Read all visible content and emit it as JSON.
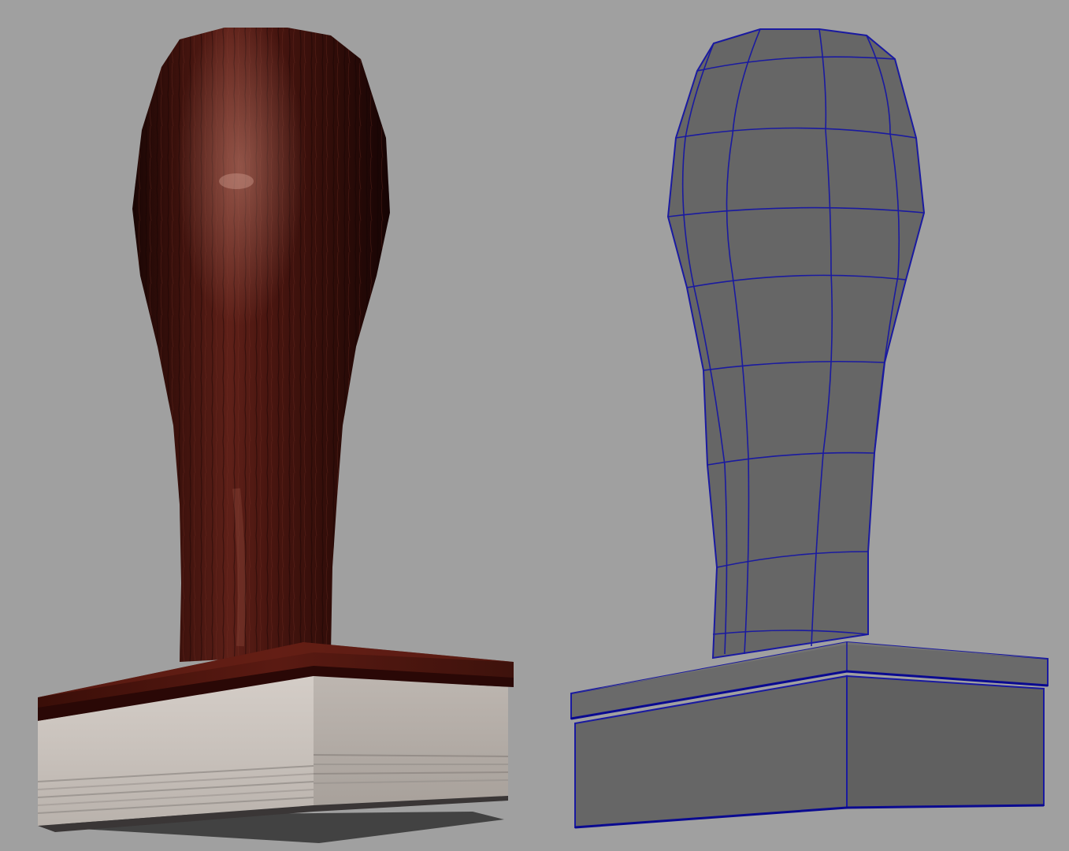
{
  "scene": {
    "background_color": "#a0a0a0",
    "textured_view": {
      "object": "rubber-stamp",
      "handle_color_dark": "#1e0806",
      "handle_color_mid": "#4a1610",
      "handle_color_light": "#6e2a20",
      "base_plate_color": "#5a1a12",
      "rubber_color": "#cdc6c0",
      "rubber_stripe_color": "#9e9893"
    },
    "wireframe_view": {
      "object": "rubber-stamp-wireframe",
      "surface_color": "#666666",
      "edge_color": "#1a1aa0"
    }
  }
}
